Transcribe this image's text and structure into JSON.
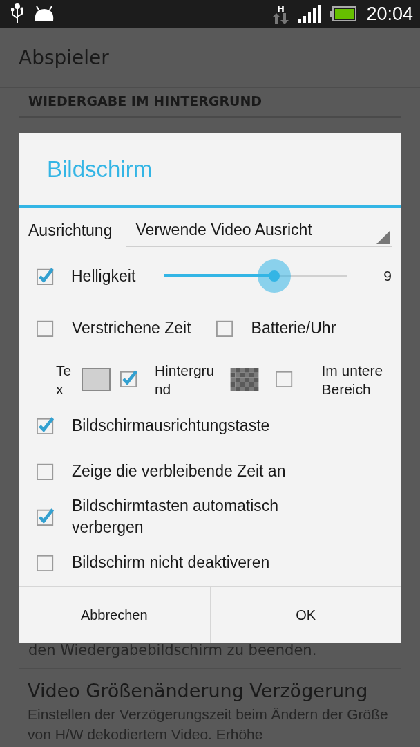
{
  "status_bar": {
    "network": "H",
    "time": "20:04"
  },
  "action_bar": {
    "title": "Abspieler"
  },
  "background": {
    "section_header": "WIEDERGABE IM HINTERGRUND",
    "summary_tail": "den Wiedergabebildschirm zu beenden.",
    "preference": {
      "title": "Video Größenänderung Verzögerung",
      "summary": "Einstellen der Verzögerungszeit beim Ändern der Größe von H/W dekodiertem Video. Erhöhe"
    }
  },
  "dialog": {
    "title": "Bildschirm",
    "orientation": {
      "label": "Ausrichtung",
      "value": "Verwende Video Ausricht"
    },
    "brightness": {
      "label": "Helligkeit",
      "checked": true,
      "level": 0.6,
      "reading": "9"
    },
    "pair": [
      {
        "label": "Verstrichene Zeit",
        "checked": false
      },
      {
        "label": "Batterie/Uhr",
        "checked": false
      }
    ],
    "overlay": [
      {
        "kind": "text-color",
        "label": "Tex"
      },
      {
        "kind": "background",
        "label": "Hintergrund",
        "checked": true
      },
      {
        "kind": "position",
        "label": "Im untere Bereich",
        "checked": false
      }
    ],
    "options": [
      {
        "label": "Bildschirmausrichtungstaste",
        "checked": true
      },
      {
        "label": "Zeige die verbleibende Zeit an",
        "checked": false
      },
      {
        "label": "Bildschirmtasten automatisch verbergen",
        "checked": true
      },
      {
        "label": "Bildschirm nicht deaktiveren",
        "checked": false
      }
    ],
    "buttons": [
      "Abbrechen",
      "OK"
    ]
  }
}
